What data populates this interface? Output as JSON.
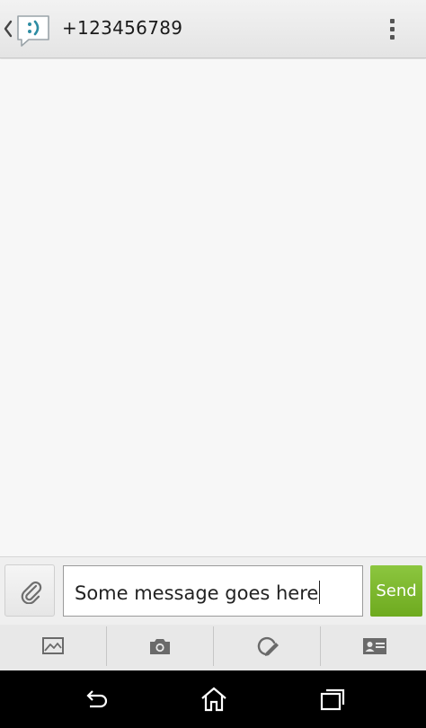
{
  "action_bar": {
    "title": "+123456789",
    "icons": [
      "back-chevron-icon",
      "messaging-app-icon",
      "overflow-menu-icon"
    ]
  },
  "compose": {
    "message_value": "Some message goes here",
    "send_label": "Send",
    "attach_icon": "paperclip-icon"
  },
  "toolbar": {
    "items": [
      "picture-icon",
      "camera-icon",
      "sketch-icon",
      "contact-card-icon"
    ]
  },
  "system_nav": {
    "items": [
      "back-icon",
      "home-icon",
      "recent-apps-icon"
    ]
  },
  "colors": {
    "send_green": "#7ab82a",
    "app_icon_teal": "#2e8da3",
    "background": "#f7f7f7"
  }
}
